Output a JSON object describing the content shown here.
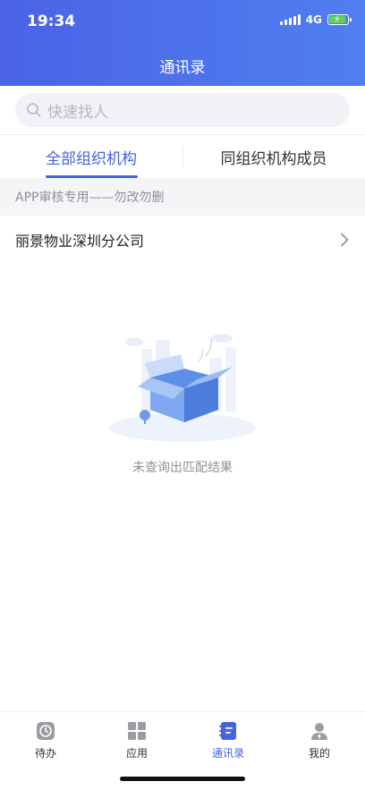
{
  "status_bar": {
    "time": "19:34",
    "network": "4G"
  },
  "header": {
    "title": "通讯录"
  },
  "search": {
    "placeholder": "快速找人"
  },
  "tabs": [
    {
      "label": "全部组织机构",
      "active": true
    },
    {
      "label": "同组织机构成员",
      "active": false
    }
  ],
  "section": {
    "title": "APP审核专用——勿改勿删"
  },
  "organizations": [
    {
      "name": "丽景物业深圳分公司"
    }
  ],
  "empty_state": {
    "message": "未查询出匹配结果"
  },
  "bottom_nav": [
    {
      "label": "待办",
      "icon": "todo-icon",
      "active": false
    },
    {
      "label": "应用",
      "icon": "apps-grid-icon",
      "active": false
    },
    {
      "label": "通讯录",
      "icon": "contacts-book-icon",
      "active": true
    },
    {
      "label": "我的",
      "icon": "profile-icon",
      "active": false
    }
  ],
  "colors": {
    "accent": "#4463dd",
    "header_start": "#4a63e6",
    "header_end": "#4f7ff0"
  }
}
